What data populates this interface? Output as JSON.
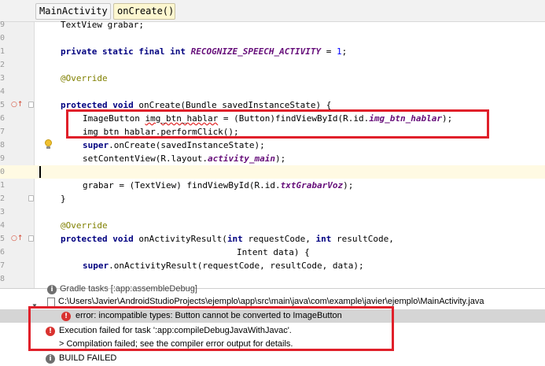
{
  "breadcrumb": {
    "items": [
      "MainActivity",
      "onCreate()"
    ]
  },
  "editor": {
    "line_numbers": [
      "9",
      "0",
      "1",
      "2",
      "3",
      "4",
      "5",
      "6",
      "7",
      "8",
      "9",
      "0",
      "1",
      "2",
      "3",
      "4",
      "5",
      "6",
      "7",
      "8"
    ],
    "code": {
      "l0": "TextView grabar;",
      "l2_kw": "private static final int ",
      "l2_field": "RECOGNIZE_SPEECH_ACTIVITY",
      "l2_eq": " = ",
      "l2_num": "1",
      "l2_end": ";",
      "l4": "@Override",
      "l6_kw": "protected void ",
      "l6_rest": "onCreate(Bundle savedInstanceState) {",
      "l7_a": "ImageButton ",
      "l7_var": "img_btn_hablar",
      "l7_b": " = (Button)findViewById(R.id.",
      "l7_field": "img_btn_hablar",
      "l7_c": ");",
      "l8": "img_btn_hablar.performClick();",
      "l9_kw": "super",
      "l9_rest": ".onCreate(savedInstanceState);",
      "l10_a": "setContentView(R.layout.",
      "l10_field": "activity_main",
      "l10_b": ");",
      "l12_a": "grabar = (TextView) findViewById(R.id.",
      "l12_field": "txtGrabarVoz",
      "l12_b": ");",
      "l13": "}",
      "l15": "@Override",
      "l16_kw": "protected void ",
      "l16_a": "onActivityResult(",
      "l16_kw2": "int ",
      "l16_b": "requestCode, ",
      "l16_kw3": "int ",
      "l16_c": "resultCode,",
      "l17": "Intent data) {",
      "l18_kw": "super",
      "l18_rest": ".onActivityResult(requestCode, resultCode, data);"
    }
  },
  "messages": {
    "partial_top": "Gradle tasks [:app:assembleDebug]",
    "file_path": "C:\\Users\\Javier\\AndroidStudioProjects\\ejemplo\\app\\src\\main\\java\\com\\example\\javier\\ejemplo\\MainActivity.java",
    "error": "error: incompatible types: Button cannot be converted to ImageButton",
    "exec_failed_1": "Execution failed for task ':app:compileDebugJavaWithJavac'.",
    "exec_failed_2": "> Compilation failed; see the compiler error output for details.",
    "build_failed": "BUILD FAILED"
  },
  "colors": {
    "highlight_box": "#e0202a",
    "caret_line": "#fffae3",
    "keyword": "#000080",
    "field": "#660e7a",
    "annotation": "#808000"
  }
}
